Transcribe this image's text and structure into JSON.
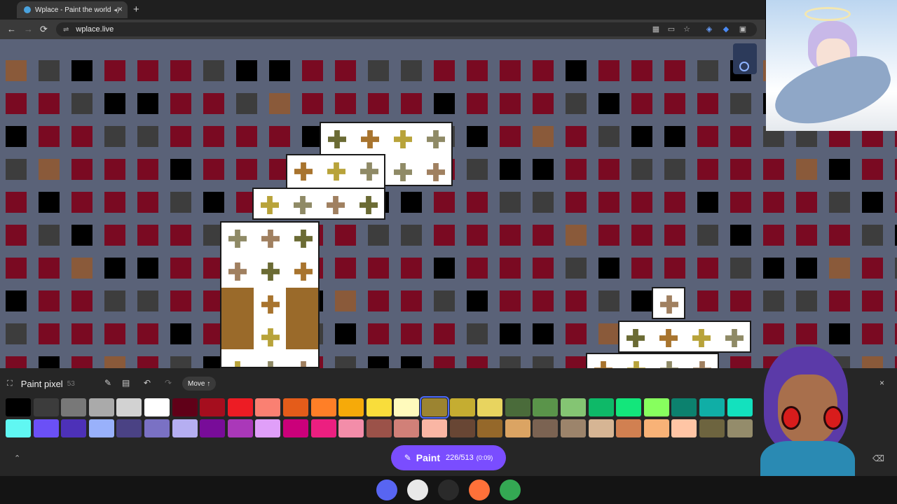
{
  "browser": {
    "tab_title": "Wplace - Paint the world",
    "tab_audio_icon": "speaker-icon",
    "tab_close": "×",
    "new_tab": "+",
    "url": "wplace.live",
    "nav_back": "←",
    "nav_forward": "→",
    "nav_reload": "⟳",
    "site_info_icon": "⇌"
  },
  "canvas": {
    "background": "#5a6278",
    "pixel_colors": [
      "#7a0a22",
      "#000000",
      "#3d3d3d",
      "#8a5a3a",
      "#c7634f",
      "#7a6a2a"
    ],
    "motif_colors": [
      "#6b6b34",
      "#a8742e",
      "#b8a33a",
      "#8f8a66",
      "#a08060"
    ]
  },
  "panel": {
    "title": "Paint pixel",
    "count": "53",
    "move_label": "Move ↑",
    "close": "×",
    "collapse": "⌃",
    "eraser_icon": "eraser-icon",
    "palette_row1": [
      "#000000",
      "#3c3c3c",
      "#787878",
      "#aaaaaa",
      "#d2d2d2",
      "#ffffff",
      "#600018",
      "#a50e1e",
      "#ed1c24",
      "#fa8072",
      "#e45c1a",
      "#ff7f27",
      "#f6aa09",
      "#f9dd3b",
      "#fffabc",
      "#9c8431",
      "#c5ad31",
      "#e8d45f",
      "#4a6b3a",
      "#5a944a",
      "#84c573",
      "#0eb968",
      "#13e67b",
      "#87ff5e",
      "#0c816e",
      "#10aea6",
      "#13e1be"
    ],
    "palette_row2": [
      "#60f7f2",
      "#6b50f6",
      "#4d31b8",
      "#99b1fb",
      "#4a4284",
      "#7a71c4",
      "#b5aef1",
      "#780c99",
      "#aa38b9",
      "#e09ff9",
      "#cb007a",
      "#ec1f80",
      "#f38da9",
      "#9b5249",
      "#d18078",
      "#fab6a4",
      "#684634",
      "#95682a",
      "#dba463",
      "#7b6352",
      "#9c846b",
      "#d6b594",
      "#d18051",
      "#f8b277",
      "#ffc5a5",
      "#6d643f",
      "#948c6b"
    ],
    "selected_color": "#9c8431",
    "paint": {
      "label": "Paint",
      "charges": "226/513",
      "timer": "(0:09)"
    }
  },
  "taskbar": {
    "apps": [
      {
        "name": "discord-icon",
        "color": "#5865f2"
      },
      {
        "name": "vrchat-icon",
        "color": "#e8e8e8"
      },
      {
        "name": "obs-icon",
        "color": "#2a2a2a"
      },
      {
        "name": "firefox-icon",
        "color": "#ff7139"
      },
      {
        "name": "chrome-icon",
        "color": "#34a853"
      }
    ]
  }
}
